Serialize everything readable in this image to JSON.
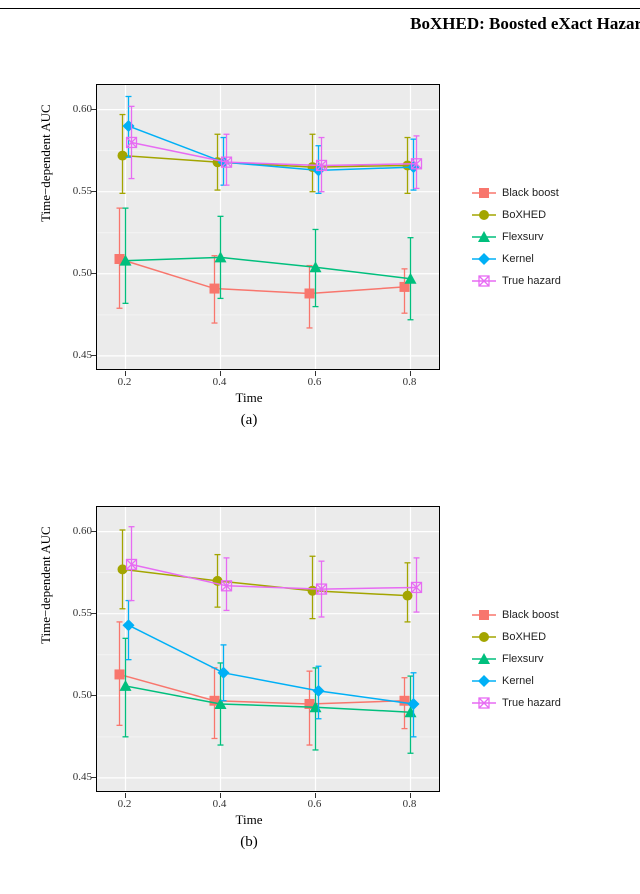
{
  "header": {
    "title": "BoXHED: Boosted eXact Hazar"
  },
  "legend": {
    "items": [
      {
        "name": "Black boost",
        "color": "#F8766D",
        "shape": "square_solid"
      },
      {
        "name": "BoXHED",
        "color": "#A3A500",
        "shape": "circle_solid"
      },
      {
        "name": "Flexsurv",
        "color": "#00BF7D",
        "shape": "triangle_solid"
      },
      {
        "name": "Kernel",
        "color": "#00B0F6",
        "shape": "diamond_solid"
      },
      {
        "name": "True hazard",
        "color": "#E76BF3",
        "shape": "square_hollow_x"
      }
    ]
  },
  "axes": {
    "ylabel": "Time−dependent AUC",
    "xlabel": "Time",
    "yticks": [
      0.45,
      0.5,
      0.55,
      0.6
    ],
    "xticks": [
      0.2,
      0.4,
      0.6,
      0.8
    ],
    "ylim": [
      0.442,
      0.615
    ],
    "xlim": [
      0.14,
      0.86
    ]
  },
  "captions": {
    "a": "(a)",
    "b": "(b)"
  },
  "chart_data": [
    {
      "id": "a",
      "type": "error_line",
      "xlabel": "Time",
      "ylabel": "Time−dependent AUC",
      "x": [
        0.2,
        0.4,
        0.6,
        0.8
      ],
      "ylim": [
        0.442,
        0.615
      ],
      "xlim": [
        0.14,
        0.86
      ],
      "series": [
        {
          "name": "Black boost",
          "color": "#F8766D",
          "shape": "square_solid",
          "y": [
            0.509,
            0.491,
            0.488,
            0.492
          ],
          "lo": [
            0.479,
            0.47,
            0.467,
            0.476
          ],
          "hi": [
            0.54,
            0.511,
            0.505,
            0.503
          ]
        },
        {
          "name": "BoXHED",
          "color": "#A3A500",
          "shape": "circle_solid",
          "y": [
            0.572,
            0.568,
            0.565,
            0.566
          ],
          "lo": [
            0.549,
            0.551,
            0.55,
            0.549
          ],
          "hi": [
            0.597,
            0.585,
            0.585,
            0.583
          ]
        },
        {
          "name": "Flexsurv",
          "color": "#00BF7D",
          "shape": "triangle_solid",
          "y": [
            0.508,
            0.51,
            0.504,
            0.497
          ],
          "lo": [
            0.482,
            0.485,
            0.48,
            0.472
          ],
          "hi": [
            0.54,
            0.535,
            0.527,
            0.522
          ]
        },
        {
          "name": "Kernel",
          "color": "#00B0F6",
          "shape": "diamond_solid",
          "y": [
            0.59,
            0.568,
            0.563,
            0.565
          ],
          "lo": [
            0.571,
            0.554,
            0.549,
            0.551
          ],
          "hi": [
            0.608,
            0.583,
            0.578,
            0.582
          ]
        },
        {
          "name": "True hazard",
          "color": "#E76BF3",
          "shape": "square_hollow_x",
          "y": [
            0.58,
            0.568,
            0.566,
            0.567
          ],
          "lo": [
            0.558,
            0.554,
            0.55,
            0.552
          ],
          "hi": [
            0.602,
            0.585,
            0.583,
            0.584
          ]
        }
      ]
    },
    {
      "id": "b",
      "type": "error_line",
      "xlabel": "Time",
      "ylabel": "Time−dependent AUC",
      "x": [
        0.2,
        0.4,
        0.6,
        0.8
      ],
      "ylim": [
        0.442,
        0.615
      ],
      "xlim": [
        0.14,
        0.86
      ],
      "series": [
        {
          "name": "Black boost",
          "color": "#F8766D",
          "shape": "square_solid",
          "y": [
            0.513,
            0.497,
            0.495,
            0.497
          ],
          "lo": [
            0.482,
            0.474,
            0.47,
            0.48
          ],
          "hi": [
            0.545,
            0.517,
            0.515,
            0.511
          ]
        },
        {
          "name": "BoXHED",
          "color": "#A3A500",
          "shape": "circle_solid",
          "y": [
            0.577,
            0.57,
            0.564,
            0.561
          ],
          "lo": [
            0.553,
            0.554,
            0.547,
            0.545
          ],
          "hi": [
            0.601,
            0.586,
            0.585,
            0.581
          ]
        },
        {
          "name": "Flexsurv",
          "color": "#00BF7D",
          "shape": "triangle_solid",
          "y": [
            0.506,
            0.495,
            0.493,
            0.49
          ],
          "lo": [
            0.475,
            0.47,
            0.467,
            0.465
          ],
          "hi": [
            0.535,
            0.52,
            0.517,
            0.512
          ]
        },
        {
          "name": "Kernel",
          "color": "#00B0F6",
          "shape": "diamond_solid",
          "y": [
            0.543,
            0.514,
            0.503,
            0.495
          ],
          "lo": [
            0.522,
            0.497,
            0.486,
            0.475
          ],
          "hi": [
            0.558,
            0.531,
            0.518,
            0.514
          ]
        },
        {
          "name": "True hazard",
          "color": "#E76BF3",
          "shape": "square_hollow_x",
          "y": [
            0.58,
            0.567,
            0.565,
            0.566
          ],
          "lo": [
            0.558,
            0.552,
            0.548,
            0.551
          ],
          "hi": [
            0.603,
            0.584,
            0.582,
            0.584
          ]
        }
      ]
    }
  ]
}
